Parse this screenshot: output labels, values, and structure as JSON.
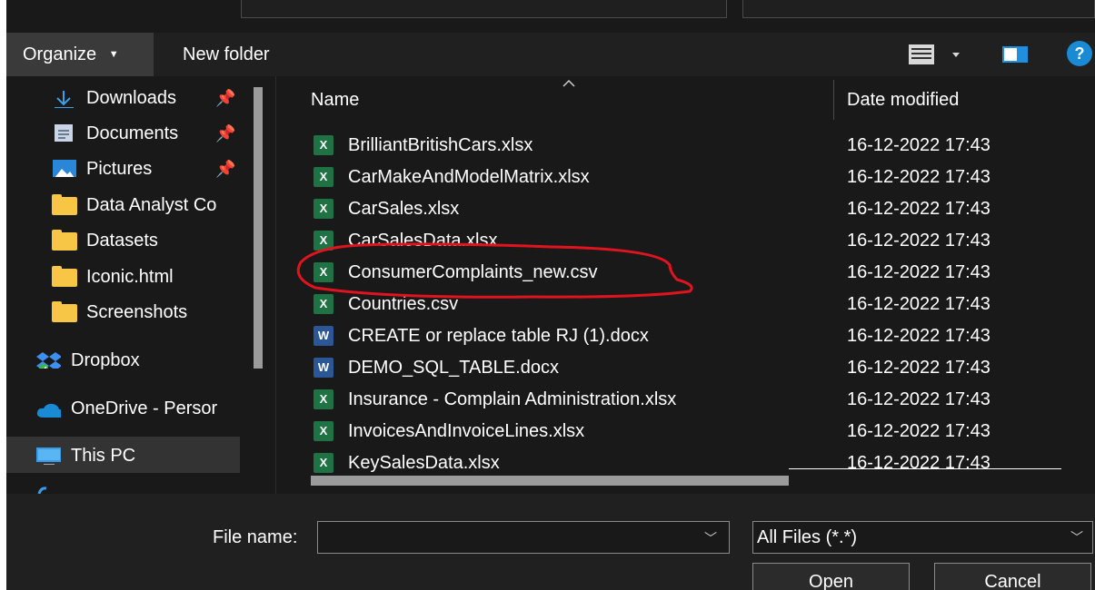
{
  "toolbar": {
    "organize_label": "Organize",
    "new_folder_label": "New folder",
    "help_label": "?"
  },
  "nav": {
    "items": [
      {
        "label": "Downloads",
        "icon": "download-icon",
        "pinned": true
      },
      {
        "label": "Documents",
        "icon": "documents-icon",
        "pinned": true
      },
      {
        "label": "Pictures",
        "icon": "pictures-icon",
        "pinned": true
      },
      {
        "label": "Data Analyst Co",
        "icon": "folder-icon",
        "pinned": false
      },
      {
        "label": "Datasets",
        "icon": "folder-icon",
        "pinned": false
      },
      {
        "label": "Iconic.html",
        "icon": "folder-icon",
        "pinned": false
      },
      {
        "label": "Screenshots",
        "icon": "folder-icon",
        "pinned": false
      },
      {
        "label": "Dropbox",
        "icon": "dropbox-icon",
        "pinned": false
      },
      {
        "label": "OneDrive - Persor",
        "icon": "onedrive-icon",
        "pinned": false
      },
      {
        "label": "This PC",
        "icon": "computer-icon",
        "pinned": false,
        "selected": true
      }
    ]
  },
  "list": {
    "columns": [
      "Name",
      "Date modified"
    ],
    "files": [
      {
        "name": "BrilliantBritishCars.xlsx",
        "date": "16-12-2022 17:43",
        "type": "excel"
      },
      {
        "name": "CarMakeAndModelMatrix.xlsx",
        "date": "16-12-2022 17:43",
        "type": "excel"
      },
      {
        "name": "CarSales.xlsx",
        "date": "16-12-2022 17:43",
        "type": "excel"
      },
      {
        "name": "CarSalesData.xlsx",
        "date": "16-12-2022 17:43",
        "type": "excel"
      },
      {
        "name": "ConsumerComplaints_new.csv",
        "date": "16-12-2022 17:43",
        "type": "excel",
        "annotated": true
      },
      {
        "name": "Countries.csv",
        "date": "16-12-2022 17:43",
        "type": "excel"
      },
      {
        "name": "CREATE or replace table RJ (1).docx",
        "date": "16-12-2022 17:43",
        "type": "word"
      },
      {
        "name": "DEMO_SQL_TABLE.docx",
        "date": "16-12-2022 17:43",
        "type": "word"
      },
      {
        "name": "Insurance - Complain Administration.xlsx",
        "date": "16-12-2022 17:43",
        "type": "excel"
      },
      {
        "name": "InvoicesAndInvoiceLines.xlsx",
        "date": "16-12-2022 17:43",
        "type": "excel"
      },
      {
        "name": "KeySalesData.xlsx",
        "date": "16-12-2022 17:43",
        "type": "excel"
      }
    ]
  },
  "bottom": {
    "file_name_label": "File name:",
    "file_name_value": "",
    "file_type_value": "All Files (*.*)",
    "open_label": "Open",
    "cancel_label": "Cancel"
  },
  "colors": {
    "background": "#191919",
    "selection": "#333333",
    "excel": "#1f7244",
    "word": "#2b5797",
    "annotation": "#e0141e",
    "help": "#1a8ad4"
  }
}
